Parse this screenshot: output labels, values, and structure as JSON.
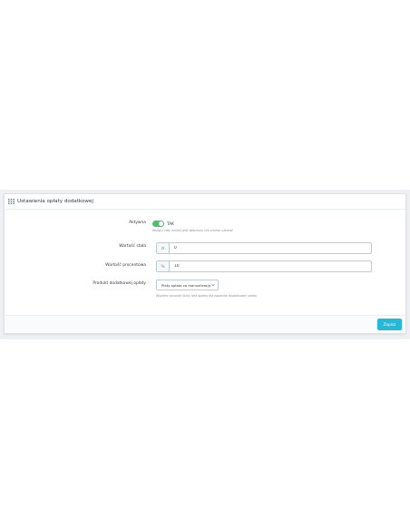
{
  "panel": {
    "title": "Ustawienia opłaty dodatkowej",
    "heading_icon": "grid-icon"
  },
  "form": {
    "active": {
      "label": "Aktywna",
      "state": true,
      "state_text": "TAK",
      "help": "Wyłącz cały moduł jeśli włączony nie chcesz używać"
    },
    "fixed_value": {
      "label": "Wartość stała",
      "addon": "zł",
      "value": "0"
    },
    "percent_value": {
      "label": "Wartość procentowa",
      "addon": "%",
      "value": "10"
    },
    "product": {
      "label": "Produkt dodatkowej opłaty",
      "selected": "Płaty opłata za manualizację",
      "help": "Wybierz produkt który jest opłatą dla zapasów dodatkowej opłaty"
    }
  },
  "footer": {
    "save_label": "Zapisz"
  },
  "colors": {
    "toggle_on": "#4bc36b",
    "primary_button": "#25b9d7",
    "page_band": "#eef0f3"
  }
}
